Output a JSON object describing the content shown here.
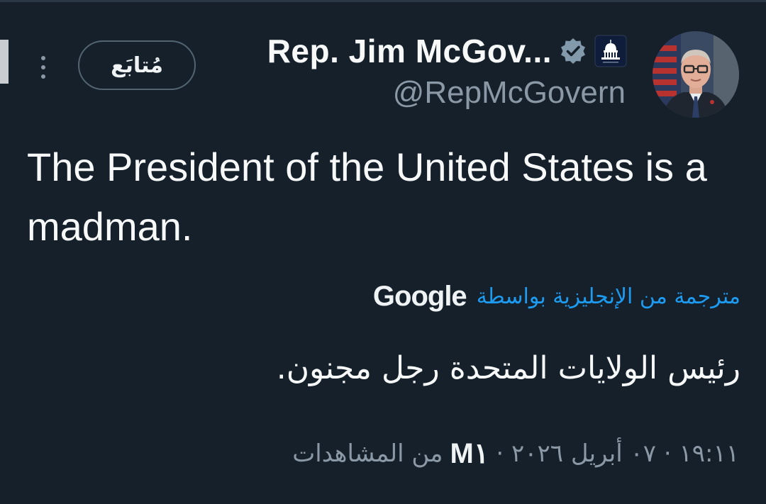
{
  "tweet": {
    "author": {
      "display_name": "Rep. Jim McGov...",
      "handle": "@RepMcGovern",
      "verified_icon": "verified-badge-icon",
      "affiliation_icon": "capitol-dome-icon",
      "avatar": "profile-photo"
    },
    "follow_label": "مُتابَع",
    "more_icon": "more-vertical-icon",
    "text": "The President of the United States is a madman.",
    "translation": {
      "translated_by_label": "مترجمة من الإنجليزية بواسطة",
      "provider": "Google",
      "text": "رئيس الولايات المتحدة رجل مجنون."
    },
    "meta": {
      "timestamp": "١٩:١١ · ٠٧ أبريل ٢٠٢٦ ·",
      "views_count": "M١",
      "views_label": "من المشاهدات"
    }
  },
  "colors": {
    "background": "#15202b",
    "text_primary": "#f7f9f9",
    "text_secondary": "#8b98a5",
    "link": "#1d9bf0",
    "border": "#536471"
  }
}
